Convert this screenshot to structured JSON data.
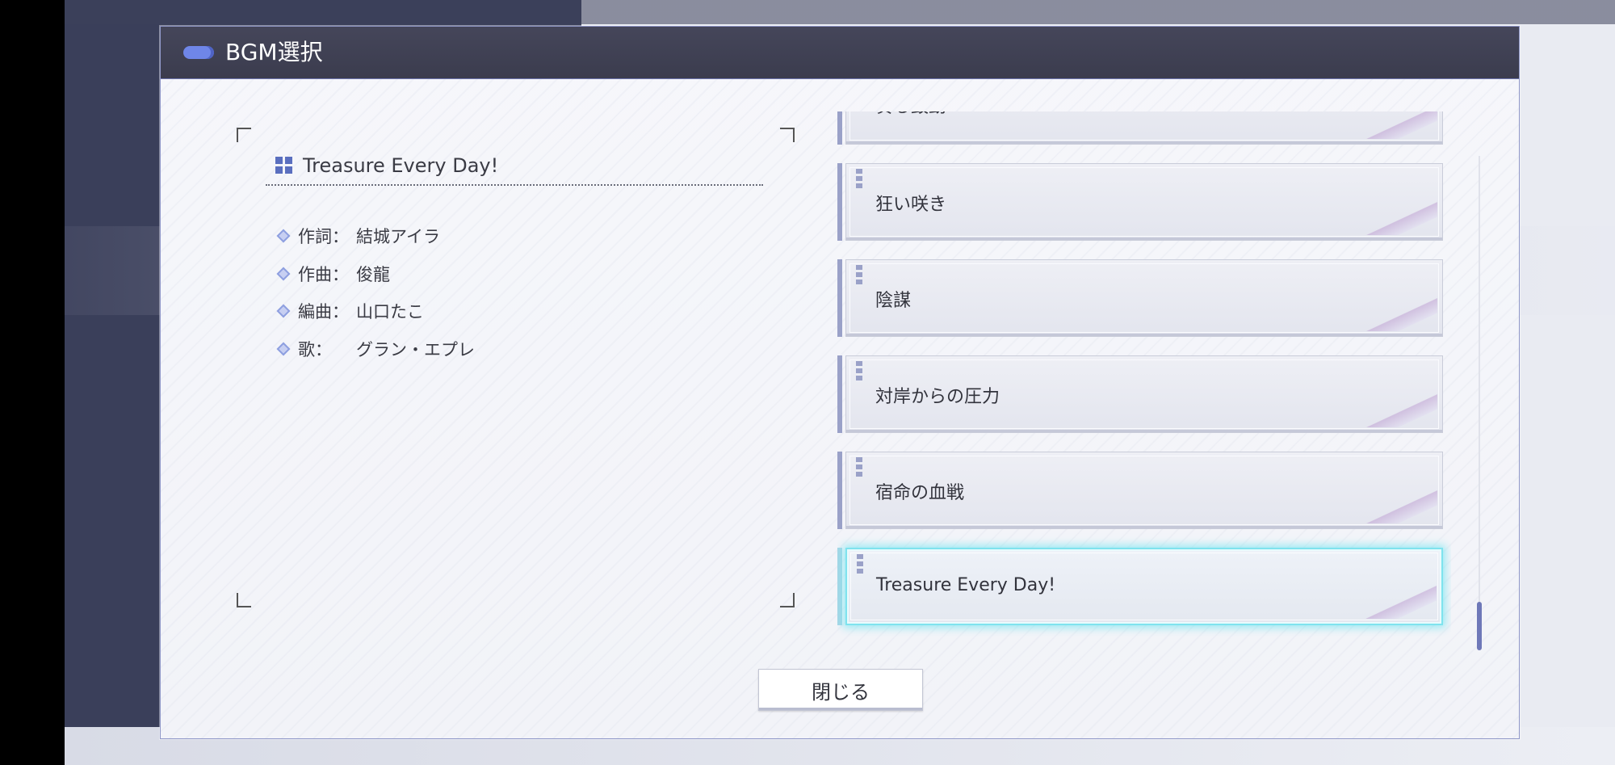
{
  "dialog": {
    "title": "BGM選択",
    "close_label": "閉じる"
  },
  "info": {
    "song_title": "Treasure Every Day!",
    "credits": [
      {
        "label": "作詞：",
        "value": "結城アイラ"
      },
      {
        "label": "作曲：",
        "value": "俊龍"
      },
      {
        "label": "編曲：",
        "value": "山口たこ"
      },
      {
        "label": "歌：",
        "value": "グラン・エプレ"
      }
    ]
  },
  "bgm_list": {
    "items": [
      {
        "label": "奏る鼓動"
      },
      {
        "label": "狂い咲き"
      },
      {
        "label": "陰謀"
      },
      {
        "label": "対岸からの圧力"
      },
      {
        "label": "宿命の血戦"
      },
      {
        "label": "Treasure Every Day!"
      }
    ],
    "selected_index": 5,
    "scroll_position": 1.0
  },
  "colors": {
    "titlebar": "#3b3c4e",
    "accent": "#6f86e8",
    "selection_glow": "#7fe3ee",
    "text": "#32333c"
  }
}
